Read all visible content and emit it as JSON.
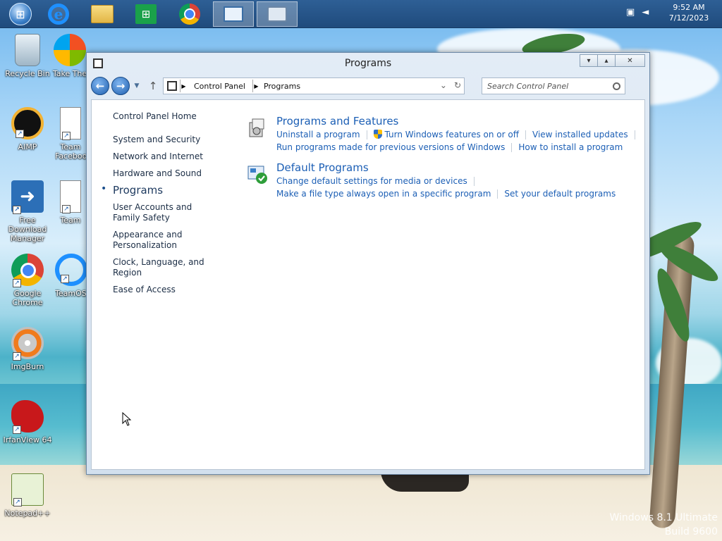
{
  "taskbar": {
    "apps": [
      {
        "name": "start",
        "icon": "windows-orb-icon"
      },
      {
        "name": "internet-explorer",
        "icon": "internet-explorer-icon"
      },
      {
        "name": "file-explorer",
        "icon": "folder-icon"
      },
      {
        "name": "store",
        "icon": "store-icon"
      },
      {
        "name": "chrome",
        "icon": "chrome-icon"
      },
      {
        "name": "control-panel",
        "icon": "control-panel-icon"
      },
      {
        "name": "on-screen-keyboard",
        "icon": "keyboard-icon"
      }
    ],
    "clock": {
      "time": "9:52 AM",
      "date": "7/12/2023"
    }
  },
  "desktop": {
    "icons": [
      {
        "label": "Recycle Bin"
      },
      {
        "label": "Take The"
      },
      {
        "label": "AIMP"
      },
      {
        "label": "Team Faceboo"
      },
      {
        "label": "Free Download Manager"
      },
      {
        "label": "Team"
      },
      {
        "label": "Google Chrome"
      },
      {
        "label": "TeamOS"
      },
      {
        "label": "ImgBurn"
      },
      {
        "label": "IrfanView 64"
      },
      {
        "label": "Notepad++"
      }
    ],
    "watermark": {
      "line1": "Windows 8.1 Ultimate",
      "line2": "Build 9600"
    }
  },
  "window": {
    "title": "Programs",
    "controls": {
      "minimize": "▾",
      "maximize": "▴",
      "close": "✕"
    },
    "address": {
      "segments": [
        "Control Panel",
        "Programs"
      ]
    },
    "search": {
      "placeholder": "Search Control Panel"
    },
    "sidebar": {
      "home": "Control Panel Home",
      "items": [
        "System and Security",
        "Network and Internet",
        "Hardware and Sound",
        "Programs",
        "User Accounts and Family Safety",
        "Appearance and Personalization",
        "Clock, Language, and Region",
        "Ease of Access"
      ],
      "current_index": 3
    },
    "sections": [
      {
        "title": "Programs and Features",
        "links": [
          "Uninstall a program",
          "Turn Windows features on or off",
          "View installed updates",
          "Run programs made for previous versions of Windows",
          "How to install a program"
        ]
      },
      {
        "title": "Default Programs",
        "links": [
          "Change default settings for media or devices",
          "Make a file type always open in a specific program",
          "Set your default programs"
        ]
      }
    ]
  }
}
